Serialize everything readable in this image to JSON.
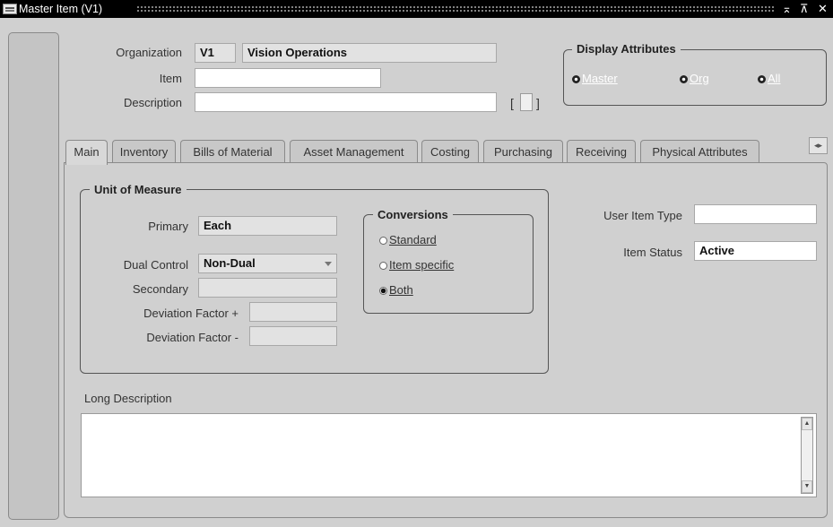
{
  "window": {
    "title": "Master Item (V1)"
  },
  "window_controls": {
    "minimize": "⌅",
    "maximize": "⊼",
    "close": "✕"
  },
  "header": {
    "organization_label": "Organization",
    "organization_code": "V1",
    "organization_name": "Vision Operations",
    "item_label": "Item",
    "item_value": "",
    "description_label": "Description",
    "description_value": "",
    "flex_open": "[",
    "flex_close": "]"
  },
  "display_attributes": {
    "title": "Display Attributes",
    "options": [
      "Master",
      "Org",
      "All"
    ],
    "selected": "All"
  },
  "tabs": [
    {
      "label": "Main",
      "active": true
    },
    {
      "label": "Inventory"
    },
    {
      "label": "Bills of Material"
    },
    {
      "label": "Asset Management"
    },
    {
      "label": "Costing"
    },
    {
      "label": "Purchasing"
    },
    {
      "label": "Receiving"
    },
    {
      "label": "Physical Attributes"
    }
  ],
  "tab_scroll_icon": "◂▸",
  "unit_of_measure": {
    "title": "Unit of Measure",
    "primary_label": "Primary",
    "primary_value": "Each",
    "dual_control_label": "Dual Control",
    "dual_control_value": "Non-Dual",
    "secondary_label": "Secondary",
    "secondary_value": "",
    "dev_plus_label": "Deviation Factor +",
    "dev_plus_value": "",
    "dev_minus_label": "Deviation Factor -",
    "dev_minus_value": ""
  },
  "conversions": {
    "title": "Conversions",
    "options": [
      "Standard",
      "Item specific",
      "Both"
    ],
    "selected": "Both"
  },
  "item_info": {
    "user_item_type_label": "User Item Type",
    "user_item_type_value": "",
    "item_status_label": "Item Status",
    "item_status_value": "Active"
  },
  "long_description": {
    "label": "Long Description",
    "value": ""
  },
  "scrollbar": {
    "up": "▲",
    "down": "▼"
  }
}
